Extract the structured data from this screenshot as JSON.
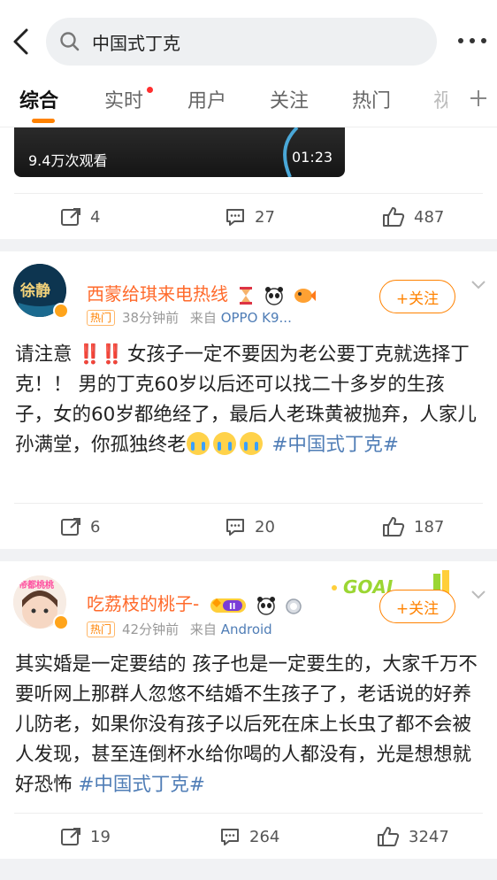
{
  "search": {
    "query": "中国式丁克"
  },
  "tabs": [
    {
      "label": "综合"
    },
    {
      "label": "实时"
    },
    {
      "label": "用户"
    },
    {
      "label": "关注"
    },
    {
      "label": "热门"
    },
    {
      "label": "视"
    }
  ],
  "video": {
    "views": "9.4万次观看",
    "duration": "01:23"
  },
  "post0_actions": {
    "reposts": "4",
    "comments": "27",
    "likes": "487"
  },
  "posts": [
    {
      "username": "西蒙给琪来电热线",
      "hot_label": "热门",
      "time": "38分钟前",
      "source": "来自",
      "device": "OPPO K9...",
      "follow_label": "+关注",
      "text_exclaim": "‼️‼️",
      "text_main": "女孩子一定不要因为老公要丁克就选择丁克！！ 男的丁克60岁以后还可以找二十多岁的生孩子，女的60岁都绝经了，最后人老珠黄被抛弃，人家儿孙满堂，你孤独终老",
      "hashtag": "#中国式丁克#",
      "reposts": "6",
      "comments": "20",
      "likes": "187",
      "avatar_text": "徐静"
    },
    {
      "username": "吃荔枝的桃子-",
      "hot_label": "热门",
      "time": "42分钟前",
      "source": "来自",
      "device": "Android",
      "follow_label": "+关注",
      "goal_text": "GOAL",
      "text_main": "其实婚是一定要结的 孩子也是一定要生的，大家千万不要听网上那群人忽悠不结婚不生孩子了，老话说的好养儿防老，如果你没有孩子以后死在床上长虫了都不会被人发现，甚至连倒杯水给你喝的人都没有，光是想想就好恐怖",
      "hashtag": "#中国式丁克#",
      "reposts": "19",
      "comments": "264",
      "likes": "3247",
      "avatar_text": "帝都桃桃"
    }
  ],
  "colors": {
    "accent": "#ff8200",
    "username": "#ff6a2b",
    "link": "#4f7db6"
  }
}
